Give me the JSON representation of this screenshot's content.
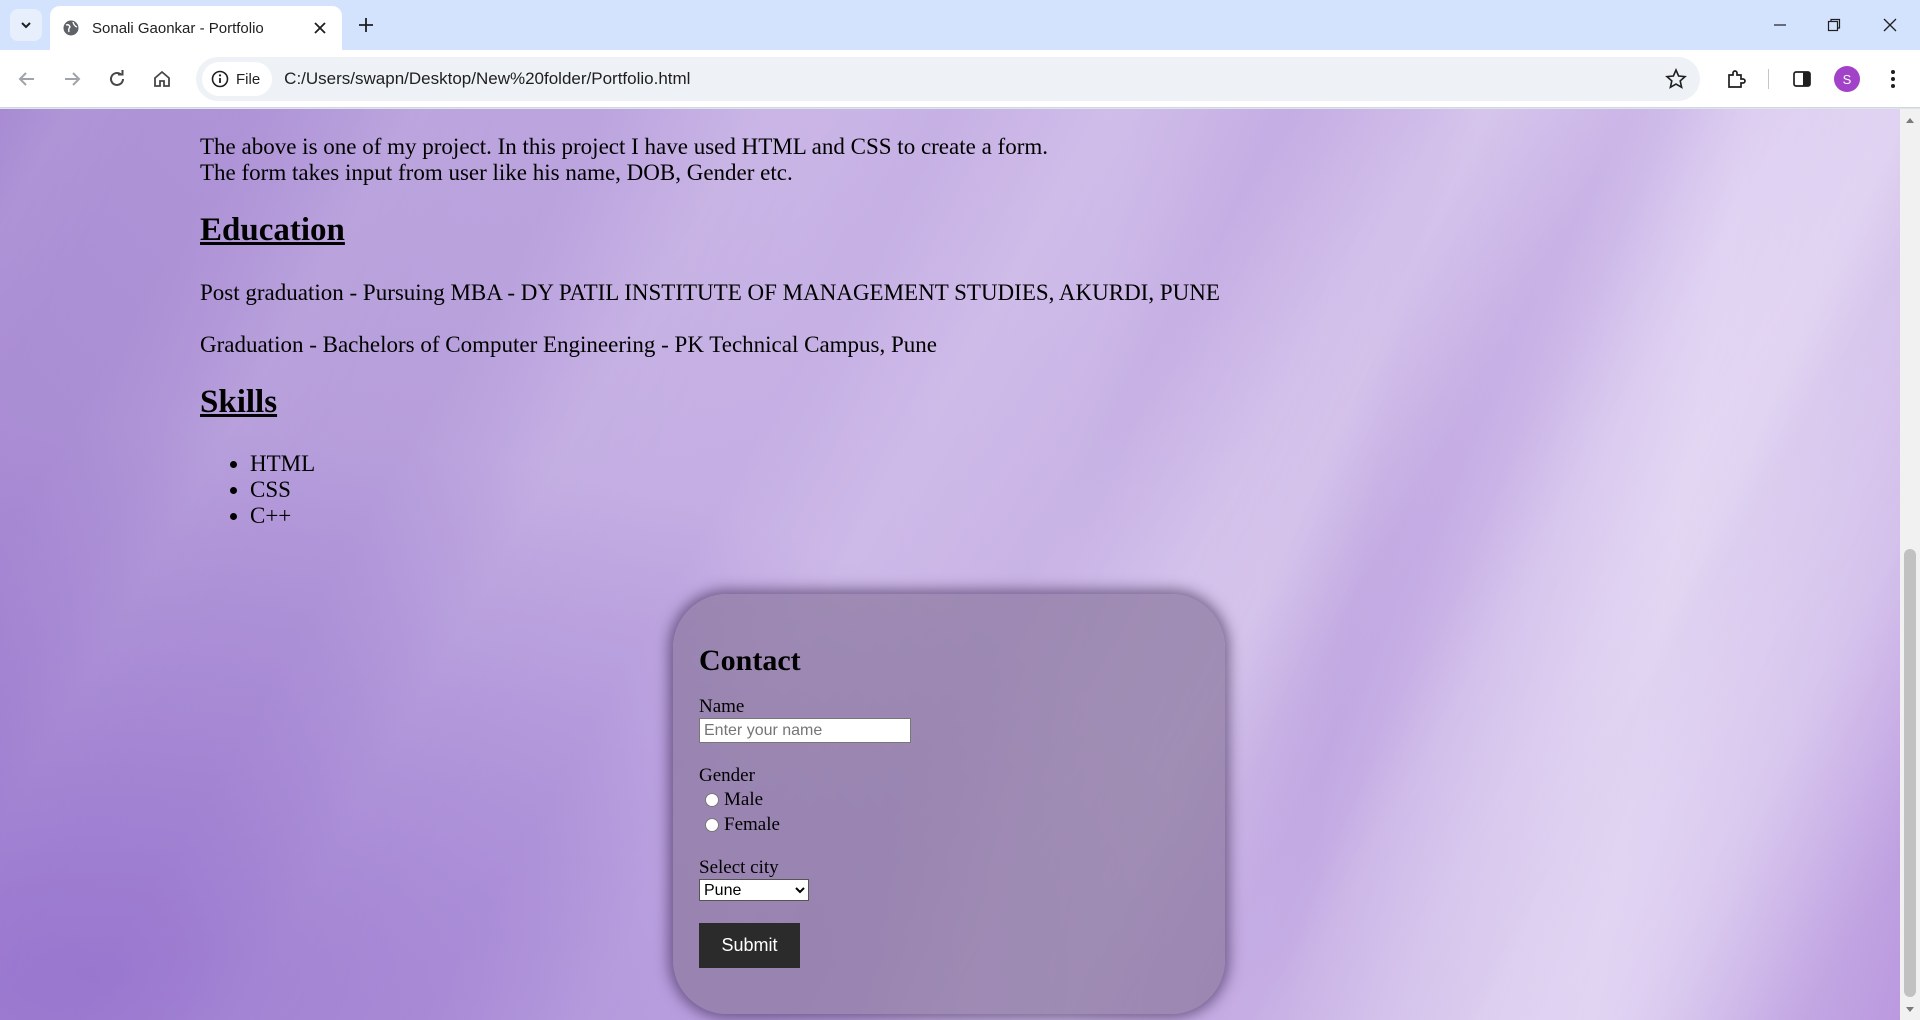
{
  "browser": {
    "tab_title": "Sonali Gaonkar - Portfolio",
    "site_chip_label": "File",
    "url": "C:/Users/swapn/Desktop/New%20folder/Portfolio.html",
    "profile_initial": "S"
  },
  "page": {
    "intro_line1": "The above is one of my project. In this project I have used HTML and CSS to create a form.",
    "intro_line2": "The form takes input from user like his name, DOB, Gender etc.",
    "education": {
      "heading": "Education",
      "post_graduation": "Post graduation - Pursuing MBA - DY PATIL INSTITUTE OF MANAGEMENT STUDIES, AKURDI, PUNE",
      "graduation": "Graduation - Bachelors of Computer Engineering - PK Technical Campus, Pune"
    },
    "skills": {
      "heading": "Skills",
      "items": [
        "HTML",
        "CSS",
        "C++"
      ]
    },
    "contact": {
      "heading": "Contact",
      "name_label": "Name",
      "name_placeholder": "Enter your name",
      "name_value": "",
      "gender_label": "Gender",
      "gender_options": [
        "Male",
        "Female"
      ],
      "city_label": "Select city",
      "city_selected": "Pune",
      "submit_label": "Submit"
    }
  }
}
